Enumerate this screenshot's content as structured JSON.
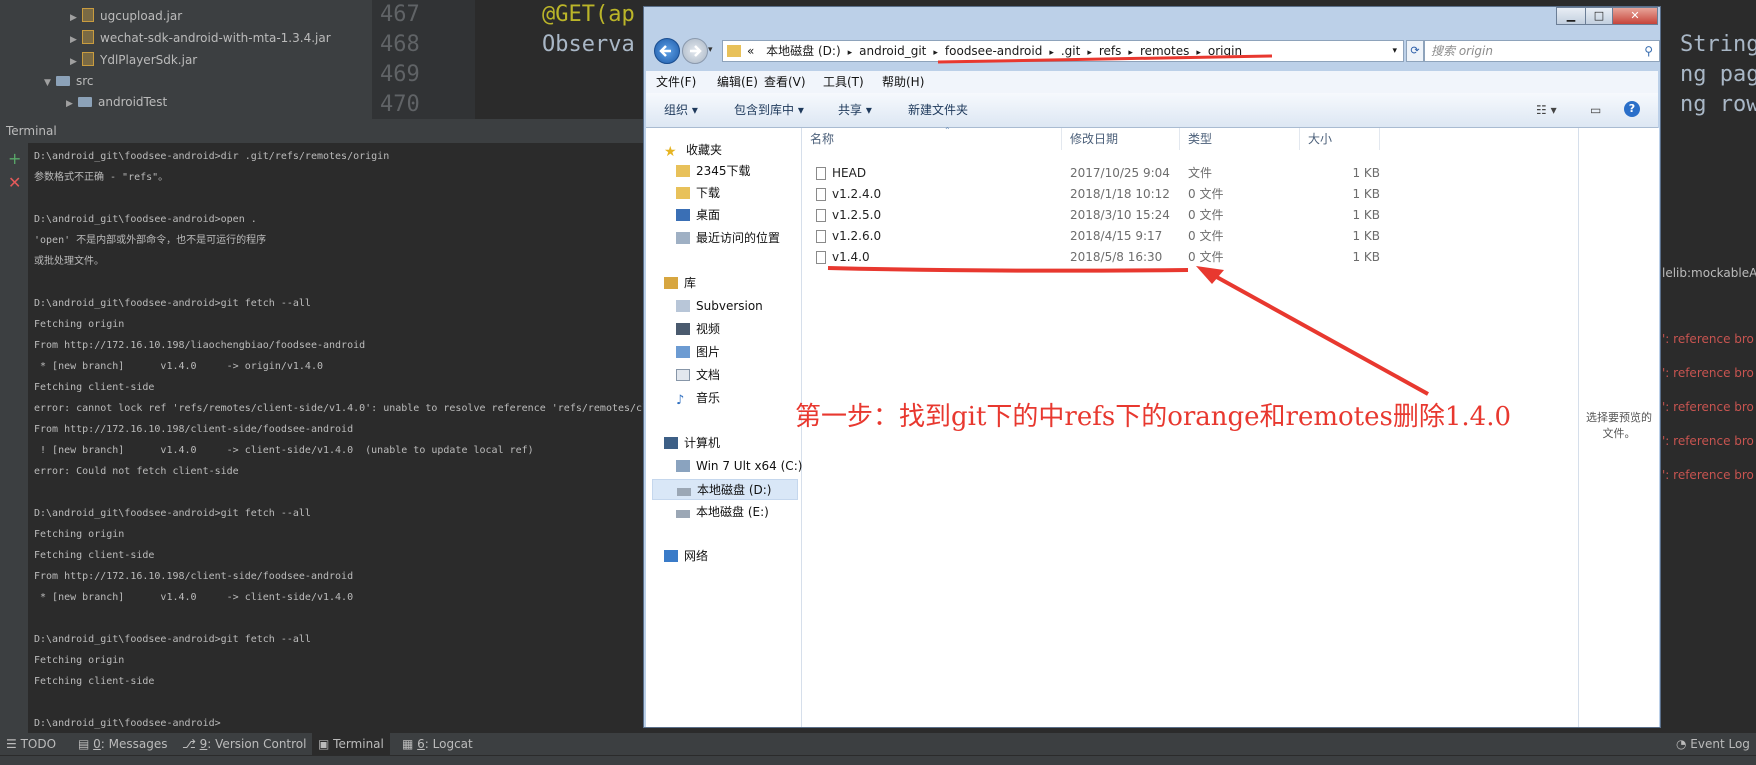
{
  "project": {
    "items": [
      {
        "label": "ugcupload.jar",
        "kind": "jar"
      },
      {
        "label": "wechat-sdk-android-with-mta-1.3.4.jar",
        "kind": "jar"
      },
      {
        "label": "YdlPlayerSdk.jar",
        "kind": "jar"
      },
      {
        "label": "src",
        "kind": "folder"
      },
      {
        "label": "androidTest",
        "kind": "folder"
      }
    ]
  },
  "editor": {
    "line_numbers": [
      "467",
      "468",
      "469",
      "470"
    ],
    "line_467": "@GET(ap",
    "line_468": "Observa",
    "right_1": "String",
    "right_2": "ng page",
    "right_3": "ng rows"
  },
  "terminal": {
    "title": "Terminal",
    "lines": [
      "D:\\android_git\\foodsee-android>dir .git/refs/remotes/origin",
      "参数格式不正确 - \"refs\"。",
      "",
      "D:\\android_git\\foodsee-android>open .",
      "'open' 不是内部或外部命令，也不是可运行的程序",
      "或批处理文件。",
      "",
      "D:\\android_git\\foodsee-android>git fetch --all",
      "Fetching origin",
      "From http://172.16.10.198/liaochengbiao/foodsee-android",
      " * [new branch]      v1.4.0     -> origin/v1.4.0",
      "Fetching client-side",
      "error: cannot lock ref 'refs/remotes/client-side/v1.4.0': unable to resolve reference 'refs/remotes/cl",
      "From http://172.16.10.198/client-side/foodsee-android",
      " ! [new branch]      v1.4.0     -> client-side/v1.4.0  (unable to update local ref)",
      "error: Could not fetch client-side",
      "",
      "D:\\android_git\\foodsee-android>git fetch --all",
      "Fetching origin",
      "Fetching client-side",
      "From http://172.16.10.198/client-side/foodsee-android",
      " * [new branch]      v1.4.0     -> client-side/v1.4.0",
      "",
      "D:\\android_git\\foodsee-android>git fetch --all",
      "Fetching origin",
      "Fetching client-side",
      "",
      "D:\\android_git\\foodsee-android>"
    ]
  },
  "right_text": {
    "mockable": "lelib:mockableA",
    "errors": [
      "': reference bro",
      "': reference bro",
      "': reference bro",
      "': reference bro",
      "': reference bro"
    ]
  },
  "bottom_bar": {
    "tools": [
      {
        "num": "",
        "label": "TODO"
      },
      {
        "num": "0",
        "label": ": Messages"
      },
      {
        "num": "9",
        "label": ": Version Control"
      },
      {
        "num": "",
        "label": "Terminal"
      },
      {
        "num": "6",
        "label": ": Logcat"
      }
    ],
    "event_log": "Event Log"
  },
  "explorer": {
    "address": {
      "overflow": "«",
      "segments": [
        "本地磁盘 (D:)",
        "android_git",
        "foodsee-android",
        ".git",
        "refs",
        "remotes",
        "origin"
      ]
    },
    "search_placeholder": "搜索 origin",
    "menu": [
      "文件(F)",
      "编辑(E)",
      "查看(V)",
      "工具(T)",
      "帮助(H)"
    ],
    "toolbar": [
      "组织 ▾",
      "包含到库中 ▾",
      "共享 ▾",
      "新建文件夹"
    ],
    "nav": {
      "favorites_title": "收藏夹",
      "favorites": [
        "2345下载",
        "下载",
        "桌面",
        "最近访问的位置"
      ],
      "libraries_title": "库",
      "libraries": [
        "Subversion",
        "视频",
        "图片",
        "文档",
        "音乐"
      ],
      "computer_title": "计算机",
      "drives": [
        "Win 7 Ult x64 (C:)",
        "本地磁盘 (D:)",
        "本地磁盘 (E:)"
      ],
      "network": "网络"
    },
    "columns": [
      "名称",
      "修改日期",
      "类型",
      "大小"
    ],
    "files": [
      {
        "name": "HEAD",
        "date": "2017/10/25 9:04",
        "type": "文件",
        "size": "1 KB"
      },
      {
        "name": "v1.2.4.0",
        "date": "2018/1/18 10:12",
        "type": "0 文件",
        "size": "1 KB"
      },
      {
        "name": "v1.2.5.0",
        "date": "2018/3/10 15:24",
        "type": "0 文件",
        "size": "1 KB"
      },
      {
        "name": "v1.2.6.0",
        "date": "2018/4/15 9:17",
        "type": "0 文件",
        "size": "1 KB"
      },
      {
        "name": "v1.4.0",
        "date": "2018/5/8 16:30",
        "type": "0 文件",
        "size": "1 KB"
      }
    ],
    "preview_text": "选择要预览的文件。"
  },
  "annotation": "第一步：找到git下的中refs下的orange和remotes删除1.4.0",
  "colors": {
    "annotation": "#e8382f",
    "error": "#c75450"
  }
}
